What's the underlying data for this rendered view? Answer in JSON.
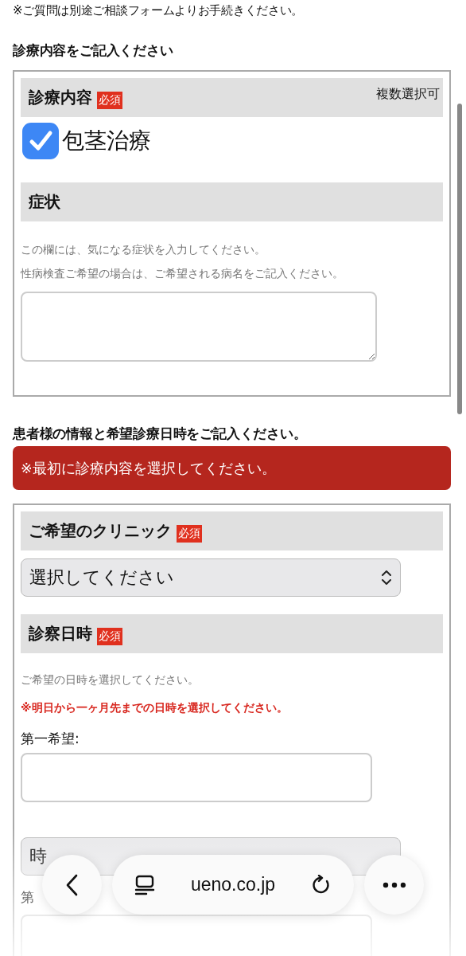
{
  "notice": "※ご質問は別途ご相談フォームよりお手続きください。",
  "section1": {
    "heading": "診療内容をご記入ください",
    "treatment": {
      "title": "診療内容",
      "badge": "必須",
      "note": "複数選択可",
      "options": [
        {
          "label": "包茎治療",
          "checked": true
        }
      ]
    },
    "symptoms": {
      "title": "症状",
      "hints": [
        "この欄には、気になる症状を入力してください。",
        "性病検査ご希望の場合は、ご希望される病名をご記入ください。"
      ]
    }
  },
  "section2": {
    "heading": "患者様の情報と希望診療日時をご記入ください。",
    "alert": "※最初に診療内容を選択してください。",
    "clinic": {
      "title": "ご希望のクリニック",
      "badge": "必須",
      "select": "選択してください"
    },
    "datetime": {
      "title": "診察日時",
      "badge": "必須",
      "hint": "ご希望の日時を選択してください。",
      "warning": "※明日から一ヶ月先までの日時を選択してください。",
      "first": {
        "label": "第一希望:",
        "time_select": "時"
      },
      "second": {
        "label": "第"
      }
    }
  },
  "browser_bar": {
    "url": "ueno.co.jp"
  }
}
